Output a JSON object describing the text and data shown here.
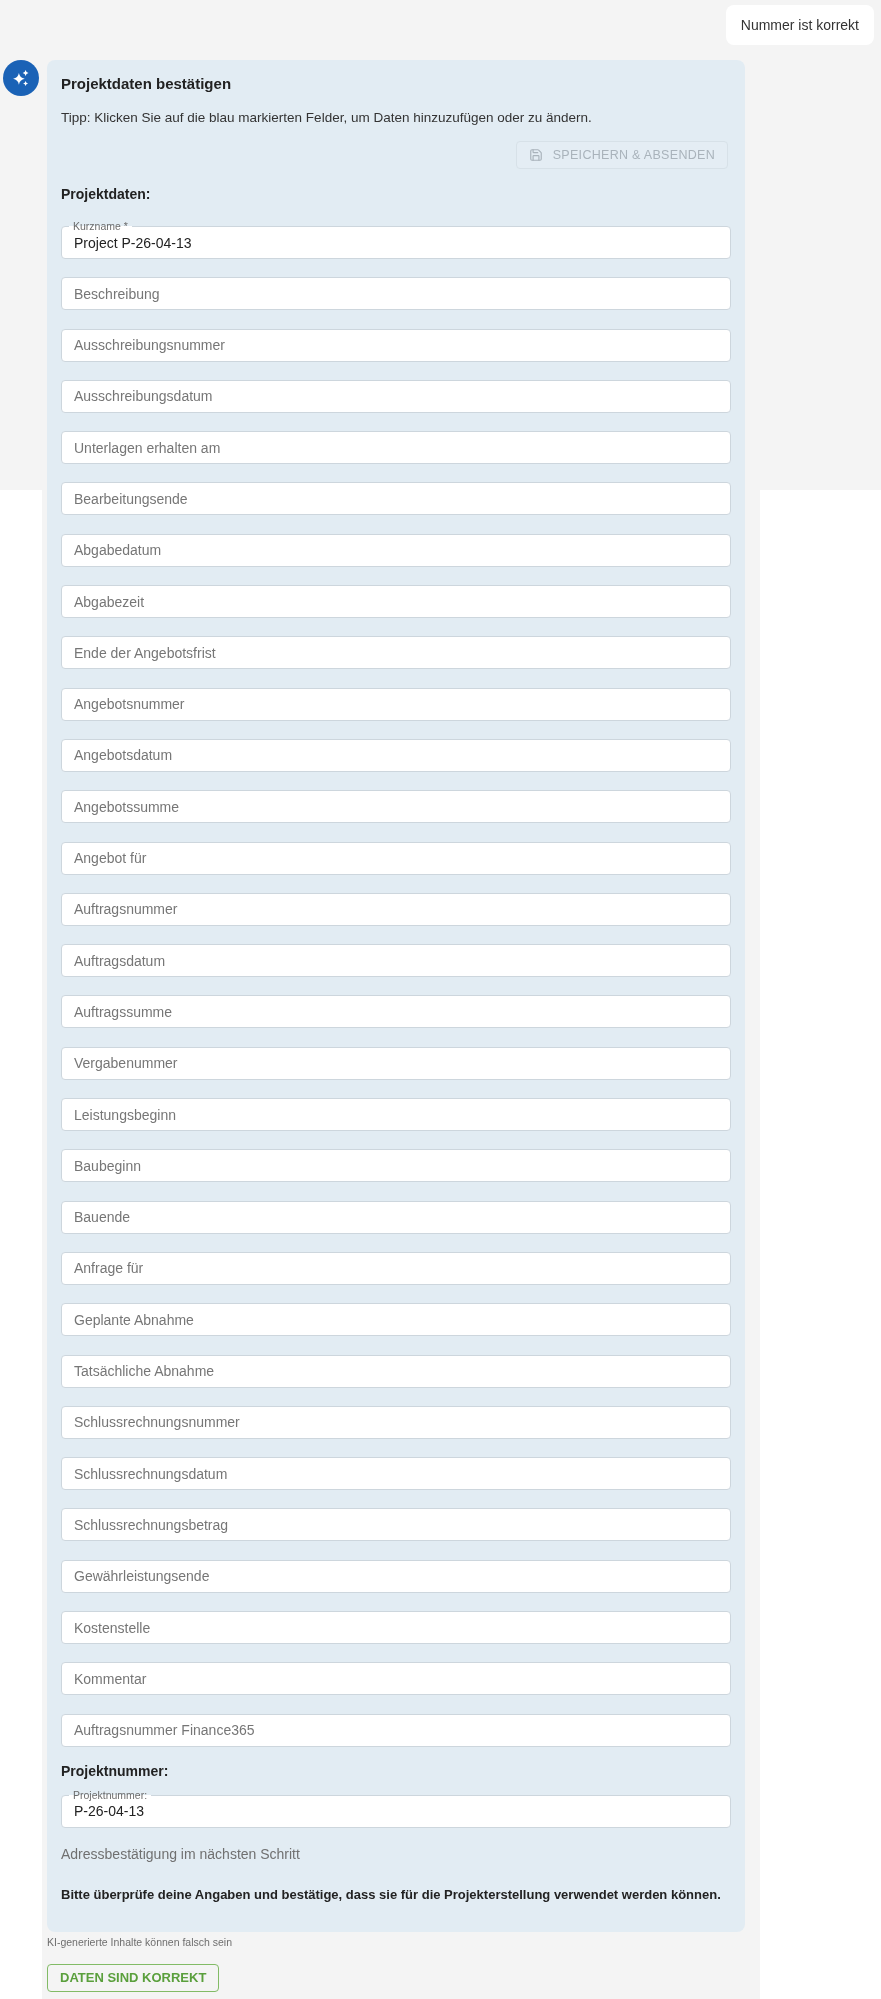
{
  "user_message": "Nummer ist korrekt",
  "card": {
    "title": "Projektdaten bestätigen",
    "tip": "Tipp: Klicken Sie auf die blau markierten Felder, um Daten hinzuzufügen oder zu ändern.",
    "save_button": {
      "label": "SPEICHERN & ABSENDEN",
      "disabled": true
    },
    "project_section": {
      "heading": "Projektdaten:",
      "fields": [
        {
          "kind": "filled",
          "label": "Kurzname *",
          "value": "Project P-26-04-13"
        },
        {
          "kind": "placeholder",
          "placeholder": "Beschreibung"
        },
        {
          "kind": "placeholder",
          "placeholder": "Ausschreibungsnummer"
        },
        {
          "kind": "placeholder",
          "placeholder": "Ausschreibungsdatum"
        },
        {
          "kind": "placeholder",
          "placeholder": "Unterlagen erhalten am"
        },
        {
          "kind": "placeholder",
          "placeholder": "Bearbeitungsende"
        },
        {
          "kind": "placeholder",
          "placeholder": "Abgabedatum"
        },
        {
          "kind": "placeholder",
          "placeholder": "Abgabezeit"
        },
        {
          "kind": "placeholder",
          "placeholder": "Ende der Angebotsfrist"
        },
        {
          "kind": "placeholder",
          "placeholder": "Angebotsnummer"
        },
        {
          "kind": "placeholder",
          "placeholder": "Angebotsdatum"
        },
        {
          "kind": "placeholder",
          "placeholder": "Angebotssumme"
        },
        {
          "kind": "placeholder",
          "placeholder": "Angebot für"
        },
        {
          "kind": "placeholder",
          "placeholder": "Auftragsnummer"
        },
        {
          "kind": "placeholder",
          "placeholder": "Auftragsdatum"
        },
        {
          "kind": "placeholder",
          "placeholder": "Auftragssumme"
        },
        {
          "kind": "placeholder",
          "placeholder": "Vergabenummer"
        },
        {
          "kind": "placeholder",
          "placeholder": "Leistungsbeginn"
        },
        {
          "kind": "placeholder",
          "placeholder": "Baubeginn"
        },
        {
          "kind": "placeholder",
          "placeholder": "Bauende"
        },
        {
          "kind": "placeholder",
          "placeholder": "Anfrage für"
        },
        {
          "kind": "placeholder",
          "placeholder": "Geplante Abnahme"
        },
        {
          "kind": "placeholder",
          "placeholder": "Tatsächliche Abnahme"
        },
        {
          "kind": "placeholder",
          "placeholder": "Schlussrechnungsnummer"
        },
        {
          "kind": "placeholder",
          "placeholder": "Schlussrechnungsdatum"
        },
        {
          "kind": "placeholder",
          "placeholder": "Schlussrechnungsbetrag"
        },
        {
          "kind": "placeholder",
          "placeholder": "Gewährleistungsende"
        },
        {
          "kind": "placeholder",
          "placeholder": "Kostenstelle"
        },
        {
          "kind": "placeholder",
          "placeholder": "Kommentar"
        },
        {
          "kind": "placeholder",
          "placeholder": "Auftragsnummer Finance365"
        }
      ]
    },
    "number_section": {
      "heading": "Projektnummer:",
      "fields": [
        {
          "kind": "filled",
          "label": "Projektnummer:",
          "value": "P-26-04-13"
        }
      ]
    },
    "address_note": "Adressbestätigung im nächsten Schritt",
    "confirm_note": "Bitte überprüfe deine Angaben und bestätige, dass sie für die Projekterstellung verwendet werden können."
  },
  "disclaimer": "KI-generierte Inhalte können falsch sein",
  "confirm_button": {
    "label": "DATEN SIND KORREKT"
  }
}
